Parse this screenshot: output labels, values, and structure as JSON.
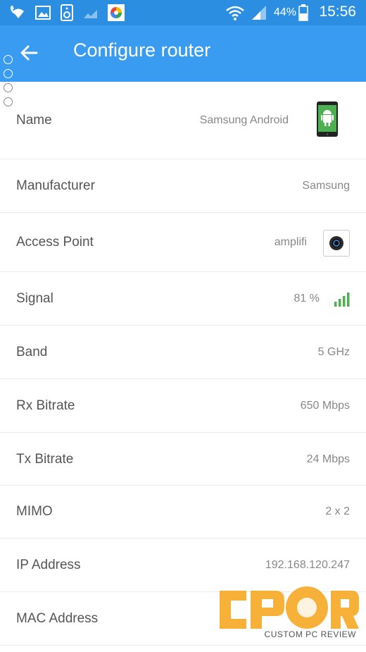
{
  "status_bar": {
    "battery_percent": "44%",
    "time": "15:56",
    "icons": [
      "wifi-calling-icon",
      "gallery-icon",
      "speaker-icon",
      "signal-weak-icon",
      "photos-app-icon",
      "wifi-icon",
      "cell-signal-icon",
      "battery-icon"
    ]
  },
  "app_bar": {
    "title": "Configure router",
    "back_icon": "arrow-left-icon"
  },
  "colors": {
    "status_bar": "#2b8ee0",
    "app_bar": "#3a9cf0",
    "signal_green": "#4caf50",
    "watermark_orange": "#f7a823"
  },
  "rows": [
    {
      "label": "Name",
      "value": "Samsung Android",
      "icon": "android-phone-icon"
    },
    {
      "label": "Manufacturer",
      "value": "Samsung"
    },
    {
      "label": "Access Point",
      "value": "amplifi",
      "icon": "amplifi-router-icon"
    },
    {
      "label": "Signal",
      "value": "81 %",
      "icon": "signal-bars-icon"
    },
    {
      "label": "Band",
      "value": "5 GHz"
    },
    {
      "label": "Rx Bitrate",
      "value": "650 Mbps"
    },
    {
      "label": "Tx Bitrate",
      "value": "24 Mbps"
    },
    {
      "label": "MIMO",
      "value": "2 x 2"
    },
    {
      "label": "IP Address",
      "value": "192.168.120.247"
    },
    {
      "label": "MAC Address",
      "value": ""
    }
  ],
  "watermark": {
    "logo": "CPCR",
    "caption": "CUSTOM PC REVIEW"
  }
}
